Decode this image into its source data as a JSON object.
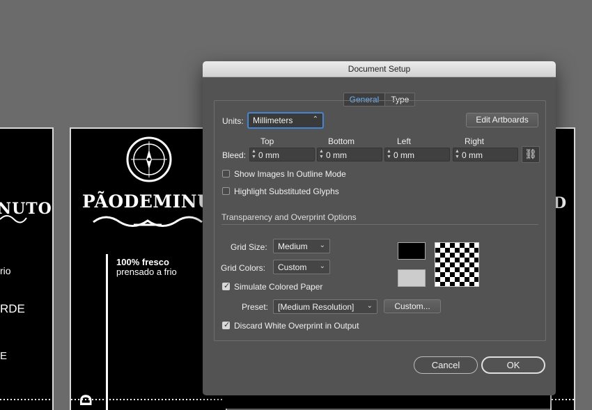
{
  "background": {
    "left_artboard": {
      "brand": "NUTO",
      "line1": "rio",
      "line2": "RDE",
      "line3": "E"
    },
    "mid_artboard": {
      "brand": "PÃO DE MINUTO",
      "brand_display": "PÃODEMINUT",
      "fresh_bold": "100% fresco",
      "fresh_regular": "prensado a frio",
      "vertical_letter": "D"
    },
    "right_artboard": {
      "brand": "D"
    }
  },
  "dialog": {
    "title": "Document Setup",
    "tabs": [
      {
        "label": "General",
        "active": true
      },
      {
        "label": "Type",
        "active": false
      }
    ],
    "units_label": "Units:",
    "units_value": "Millimeters",
    "edit_artboards_label": "Edit Artboards",
    "bleed_label": "Bleed:",
    "bleed": {
      "top": {
        "label": "Top",
        "value": "0 mm"
      },
      "bottom": {
        "label": "Bottom",
        "value": "0 mm"
      },
      "left": {
        "label": "Left",
        "value": "0 mm"
      },
      "right": {
        "label": "Right",
        "value": "0 mm"
      }
    },
    "show_images_outline": {
      "label": "Show Images In Outline Mode",
      "checked": false
    },
    "highlight_glyphs": {
      "label": "Highlight Substituted Glyphs",
      "checked": false
    },
    "transparency_section": "Transparency and Overprint Options",
    "grid_size_label": "Grid Size:",
    "grid_size_value": "Medium",
    "grid_colors_label": "Grid Colors:",
    "grid_colors_value": "Custom",
    "simulate_paper": {
      "label": "Simulate Colored Paper",
      "checked": true
    },
    "preset_label": "Preset:",
    "preset_value": "[Medium Resolution]",
    "custom_button": "Custom...",
    "discard_white": {
      "label": "Discard White Overprint in Output",
      "checked": true
    },
    "cancel_label": "Cancel",
    "ok_label": "OK",
    "colors": {
      "swatch_dark": "#000000",
      "swatch_light": "#cccccc",
      "accent": "#6fb1f5"
    }
  }
}
